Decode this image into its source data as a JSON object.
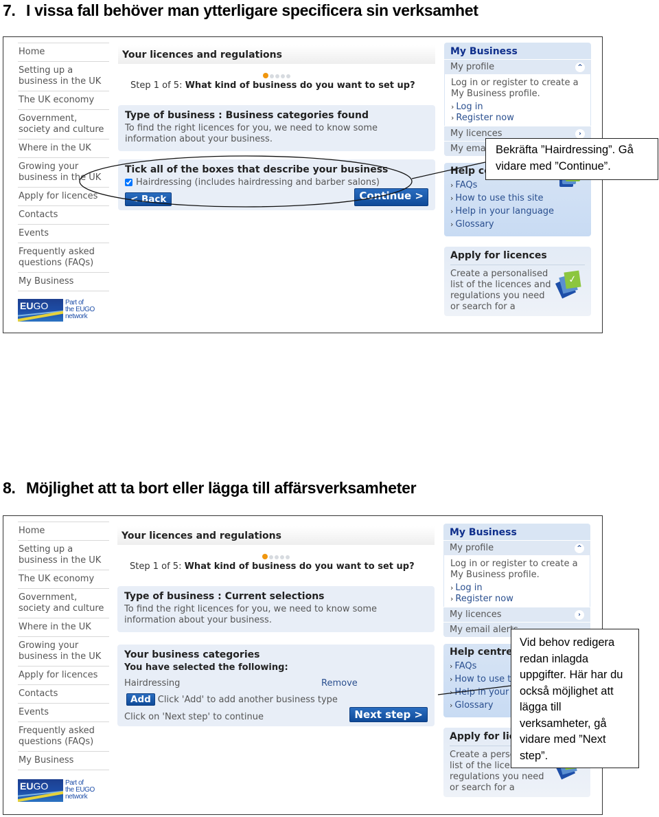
{
  "sections": [
    {
      "number": "7.",
      "heading": "I vissa fall behöver man ytterligare specificera sin verksamhet",
      "callout": "Bekräfta ”Hairdressing”. Gå vidare med ”Continue”.",
      "panel_title": "Type of business : Business categories found"
    },
    {
      "number": "8.",
      "heading": "Möjlighet att ta bort eller lägga till affärsverksamheter",
      "callout": "Vid behov redigera redan inlagda uppgifter. Här har du också möjlighet att lägga till verksamheter, gå vidare med ”Next step”.",
      "panel_title": "Type of business : Current selections"
    }
  ],
  "left_nav": [
    {
      "label": "Home"
    },
    {
      "label": "Setting up a business in the UK"
    },
    {
      "label": "The UK economy"
    },
    {
      "label": "Government, society and culture"
    },
    {
      "label": "Where in the UK"
    },
    {
      "label": "Growing your business in the UK"
    },
    {
      "label": "Apply for licences"
    },
    {
      "label": "Contacts"
    },
    {
      "label": "Events"
    },
    {
      "label": "Frequently asked questions (FAQs)"
    },
    {
      "label": "My Business"
    }
  ],
  "eugo": {
    "logo_bold": "EU",
    "logo_light": "GO",
    "tagline": [
      "Part of",
      "the EUGO",
      "network"
    ]
  },
  "main": {
    "title": "Your licences and regulations",
    "progress": {
      "current_step": 1,
      "total_steps": 5
    },
    "step_prefix": "Step 1 of 5:",
    "step_question": "What kind of business do you want to set up?",
    "panel_text": "To find the right licences for you, we need to know some information about your business."
  },
  "screen1": {
    "tick_title": "Tick all of the boxes that describe your business",
    "checkbox_label": "Hairdressing (includes hairdressing and barber salons)",
    "checkbox_checked": true,
    "back_label": "< Back",
    "continue_label": "Continue >"
  },
  "screen2": {
    "categories_title": "Your business categories",
    "selected_label": "You have selected the following:",
    "selected_item": "Hairdressing",
    "remove_label": "Remove",
    "add_label": "Add",
    "add_hint": "Click 'Add' to add another business type",
    "next_hint": "Click on 'Next step' to continue",
    "next_label": "Next step >"
  },
  "sidebar": {
    "my_business_title": "My Business",
    "my_profile": "My profile",
    "profile_text": "Log in or register to create a My Business profile.",
    "login": "Log in",
    "register": "Register now",
    "my_licences": "My licences",
    "my_email_alerts": "My email alerts",
    "help_title": "Help centre",
    "help_links": [
      "FAQs",
      "How to use this site",
      "Help in your language",
      "Glossary"
    ],
    "apply_title": "Apply for licences",
    "apply_text": "Create a personalised list of the licences and regulations you need or search for a"
  },
  "colors": {
    "accent_blue": "#0f4a98",
    "panel_bg": "#e8eef7",
    "progress_active": "#f0960e",
    "help_icon_green": "#8cc63f"
  }
}
